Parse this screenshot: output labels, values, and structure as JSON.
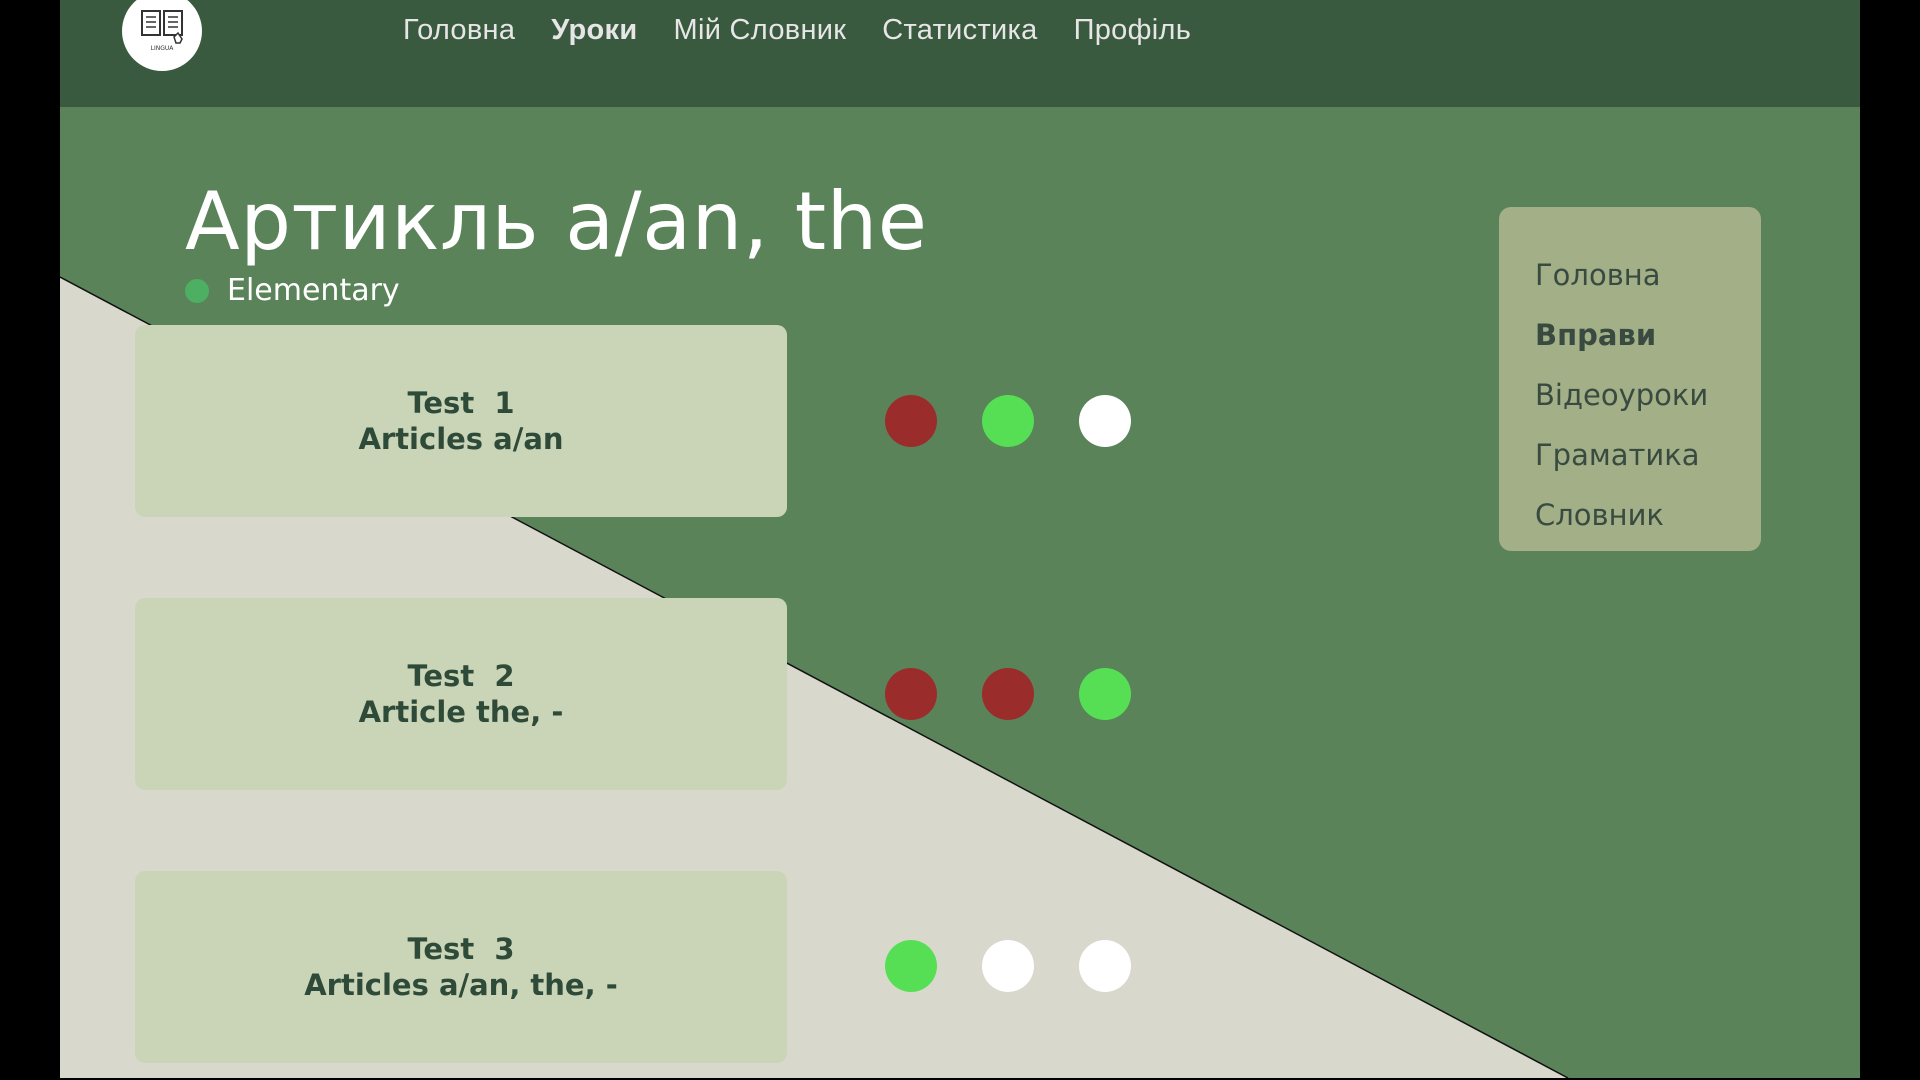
{
  "header": {
    "logo_text": "LINGUA",
    "nav": [
      {
        "label": "Головна",
        "active": false
      },
      {
        "label": "Уроки",
        "active": true
      },
      {
        "label": "Мій Словник",
        "active": false
      },
      {
        "label": "Статистика",
        "active": false
      },
      {
        "label": "Профіль",
        "active": false
      }
    ]
  },
  "lesson": {
    "title": "Артикль a/an, the",
    "level": "Elementary"
  },
  "tests": [
    {
      "line1": "Test  1",
      "line2": "Articles a/an",
      "results": [
        "red",
        "green",
        "white"
      ]
    },
    {
      "line1": "Test  2",
      "line2": "Article the, -",
      "results": [
        "red",
        "red",
        "green"
      ]
    },
    {
      "line1": "Test  3",
      "line2": "Articles a/an, the, -",
      "results": [
        "green",
        "white",
        "white"
      ]
    }
  ],
  "side_menu": {
    "items": [
      {
        "label": "Головна",
        "active": false
      },
      {
        "label": "Вправи",
        "active": true
      },
      {
        "label": "Відеоуроки",
        "active": false
      },
      {
        "label": "Граматика",
        "active": false
      },
      {
        "label": "Словник",
        "active": false
      }
    ]
  },
  "colors": {
    "header_bg": "#3a5a40",
    "main_green": "#5a8359",
    "beige": "#d9d8cd",
    "card_bg": "#cad5b7",
    "side_menu_bg": "#a2af87",
    "result_red": "#9b2c2c",
    "result_green": "#56df55",
    "result_white": "#ffffff"
  }
}
